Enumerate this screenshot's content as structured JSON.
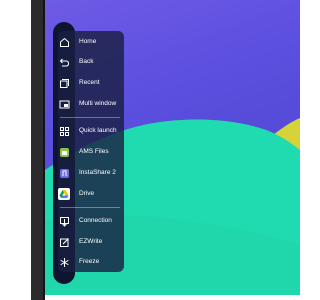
{
  "wallpaper": {
    "colors": {
      "violet": "#5b4fdf",
      "teal": "#21dbb0",
      "yellow": "#d6d23a"
    }
  },
  "side_menu": {
    "items": [
      {
        "label": "Home",
        "icon": "home-icon"
      },
      {
        "label": "Back",
        "icon": "back-arrow-icon"
      },
      {
        "label": "Recent",
        "icon": "recent-apps-icon"
      },
      {
        "label": "Multi window",
        "icon": "multi-window-icon"
      },
      {
        "label": "Quick launch",
        "icon": "grid-icon"
      },
      {
        "label": "AMS Files",
        "icon": "ams-files-icon"
      },
      {
        "label": "InstaShare 2",
        "icon": "instashare-icon"
      },
      {
        "label": "Drive",
        "icon": "google-drive-icon"
      },
      {
        "label": "Connection",
        "icon": "connection-icon"
      },
      {
        "label": "EZWrite",
        "icon": "ezwrite-icon"
      },
      {
        "label": "Freeze",
        "icon": "freeze-icon"
      }
    ],
    "colors": {
      "panel": "#1a2042",
      "bar": "#0f1430",
      "text": "#ffffff"
    }
  }
}
